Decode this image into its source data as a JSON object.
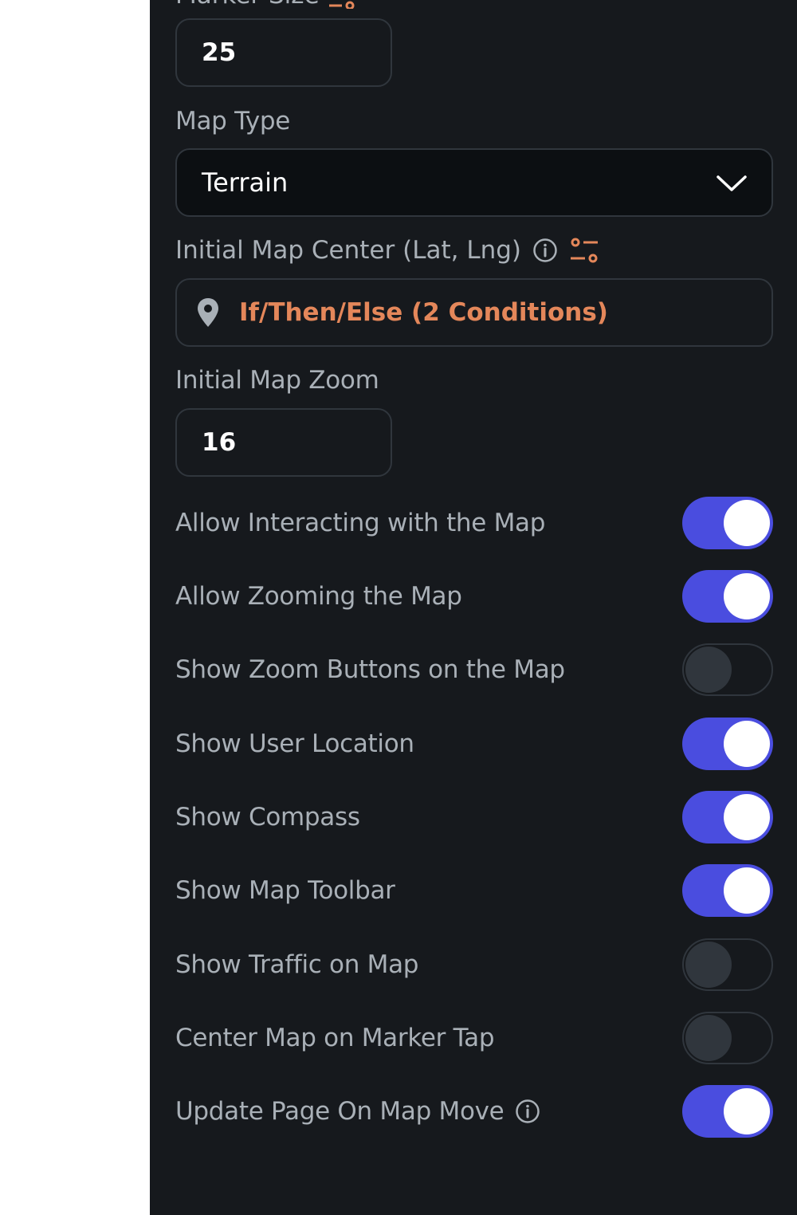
{
  "marker_size": {
    "label": "Marker Size",
    "value": "25",
    "accent_color": "#e4875a"
  },
  "map_type": {
    "label": "Map Type",
    "selected": "Terrain",
    "icon": "chevron-down-icon"
  },
  "initial_map_center": {
    "label": "Initial Map Center (Lat, Lng)",
    "info_icon": "info-icon",
    "variable_icon": "variable-settings-icon",
    "value": "If/Then/Else (2 Conditions)",
    "value_icon": "location-pin-icon",
    "value_color": "#e4875a"
  },
  "initial_map_zoom": {
    "label": "Initial Map Zoom",
    "value": "16"
  },
  "toggles": [
    {
      "label": "Allow Interacting with the Map",
      "on": true
    },
    {
      "label": "Allow Zooming the Map",
      "on": true
    },
    {
      "label": "Show Zoom Buttons on the Map",
      "on": false
    },
    {
      "label": "Show User Location",
      "on": true
    },
    {
      "label": "Show Compass",
      "on": true
    },
    {
      "label": "Show Map Toolbar",
      "on": true
    },
    {
      "label": "Show Traffic on Map",
      "on": false
    },
    {
      "label": "Center Map on Marker Tap",
      "on": false
    },
    {
      "label": "Update Page On Map Move",
      "on": true,
      "info_icon": "info-icon"
    }
  ],
  "colors": {
    "panel_bg": "#16191d",
    "toggle_on": "#4a4ddf",
    "border": "#30363d",
    "label": "#a9b0b7"
  }
}
